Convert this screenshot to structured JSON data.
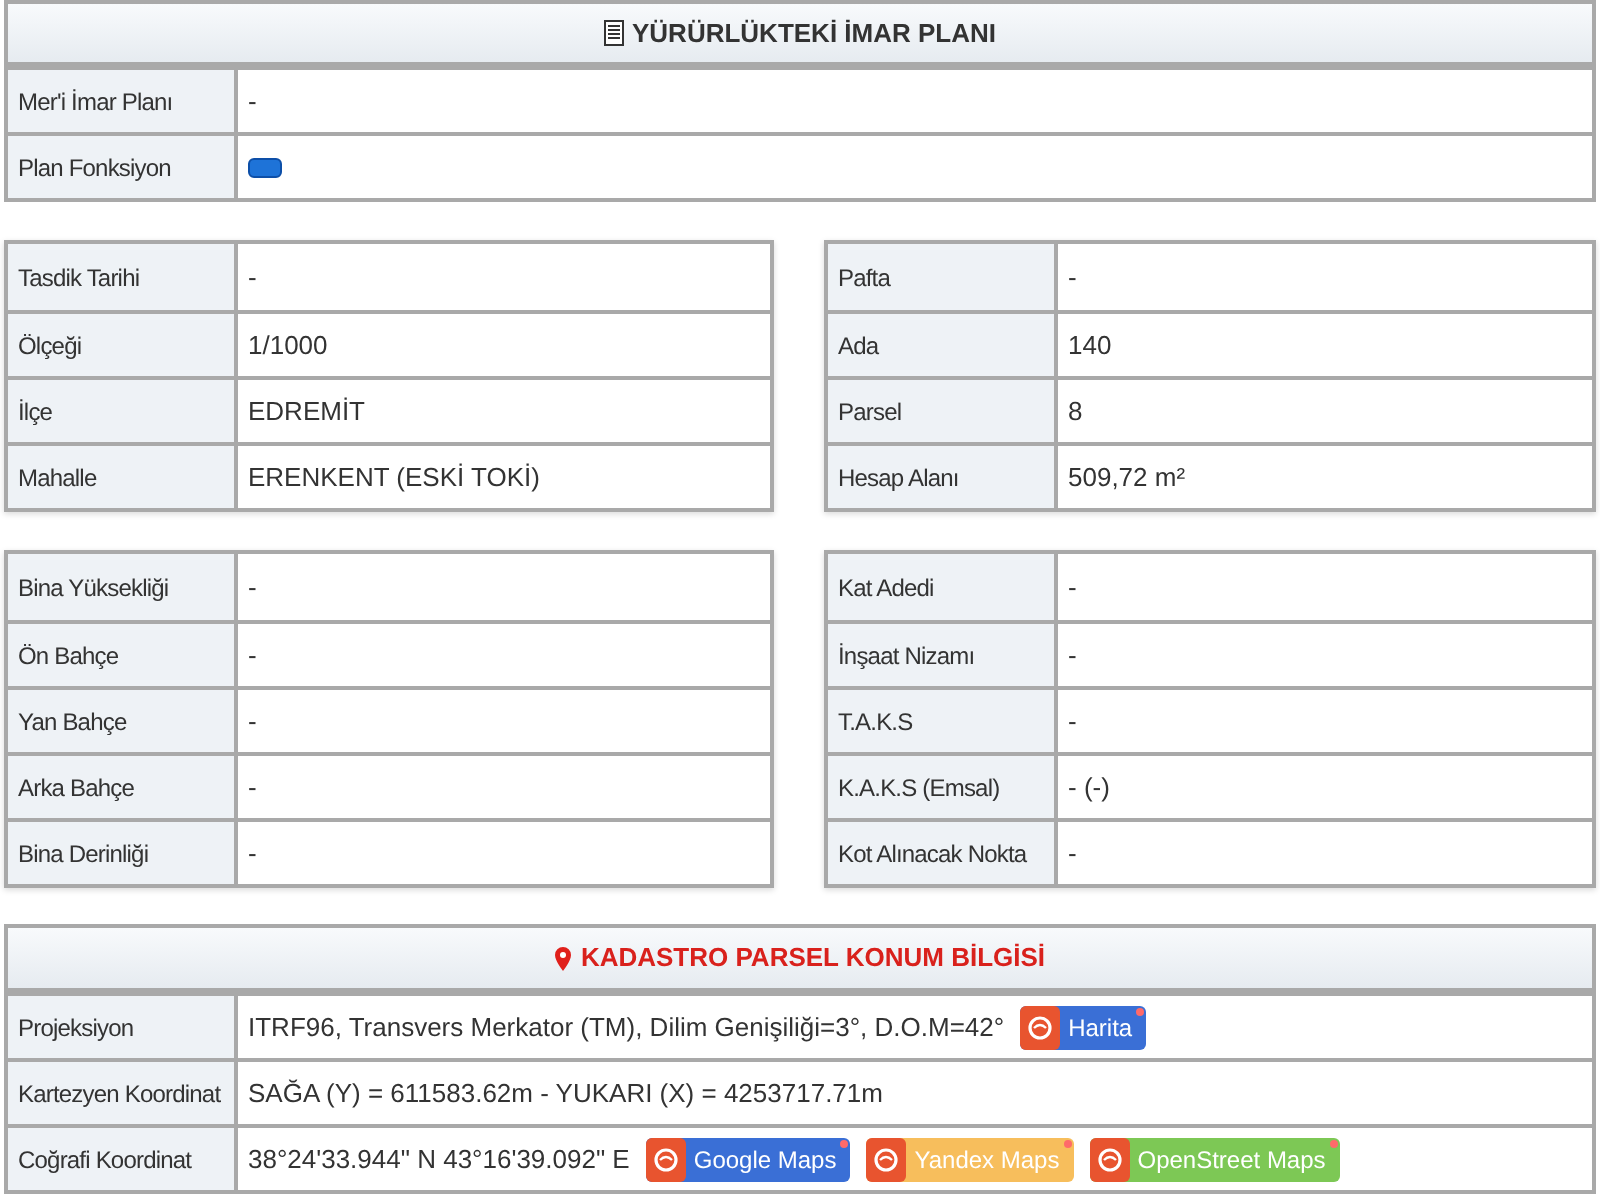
{
  "plan": {
    "title": "YÜRÜRLÜKTEKİ İMAR PLANI",
    "rows": [
      {
        "label": "Mer'i İmar Planı",
        "value": "-"
      },
      {
        "label": "Plan Fonksiyon",
        "kind": "swatch",
        "color": "#1e73d8"
      }
    ]
  },
  "parcel_left": [
    {
      "label": "Tasdik Tarihi",
      "value": "-"
    },
    {
      "label": "Ölçeği",
      "value": "1/1000"
    },
    {
      "label": "İlçe",
      "value": "EDREMİT"
    },
    {
      "label": "Mahalle",
      "value": "ERENKENT (ESKİ TOKİ)"
    }
  ],
  "parcel_right": [
    {
      "label": "Pafta",
      "value": "-"
    },
    {
      "label": "Ada",
      "value": "140"
    },
    {
      "label": "Parsel",
      "value": "8"
    },
    {
      "label": "Hesap Alanı",
      "value": "509,72 m²"
    }
  ],
  "building_left": [
    {
      "label": "Bina Yüksekliği",
      "value": "-"
    },
    {
      "label": "Ön Bahçe",
      "value": "-"
    },
    {
      "label": "Yan Bahçe",
      "value": "-"
    },
    {
      "label": "Arka Bahçe",
      "value": "-"
    },
    {
      "label": "Bina Derinliği",
      "value": "-"
    }
  ],
  "building_right": [
    {
      "label": "Kat Adedi",
      "value": "-"
    },
    {
      "label": "İnşaat Nizamı",
      "value": "-"
    },
    {
      "label": "T.A.K.S",
      "value": "-"
    },
    {
      "label": "K.A.K.S (Emsal)",
      "value": "- (-)"
    },
    {
      "label": "Kot Alınacak Nokta",
      "value": "-"
    }
  ],
  "location": {
    "title": "KADASTRO PARSEL KONUM BİLGİSİ",
    "rows": [
      {
        "label": "Projeksiyon",
        "value": "ITRF96, Transvers Merkator (TM), Dilim Genişiliği=3°, D.O.M=42°",
        "links": [
          {
            "label": "Harita",
            "color": "#3a6fd6"
          }
        ]
      },
      {
        "label": "Kartezyen Koordinat",
        "value": "SAĞA (Y) = 611583.62m - YUKARI (X) = 4253717.71m"
      },
      {
        "label": "Coğrafi Koordinat",
        "value": "38°24'33.944\" N 43°16'39.092\" E",
        "links": [
          {
            "label": "Google Maps",
            "color": "#3a6fd6"
          },
          {
            "label": "Yandex Maps",
            "color": "#f7be5c"
          },
          {
            "label": "OpenStreet Maps",
            "color": "#7dc855"
          }
        ]
      }
    ]
  }
}
